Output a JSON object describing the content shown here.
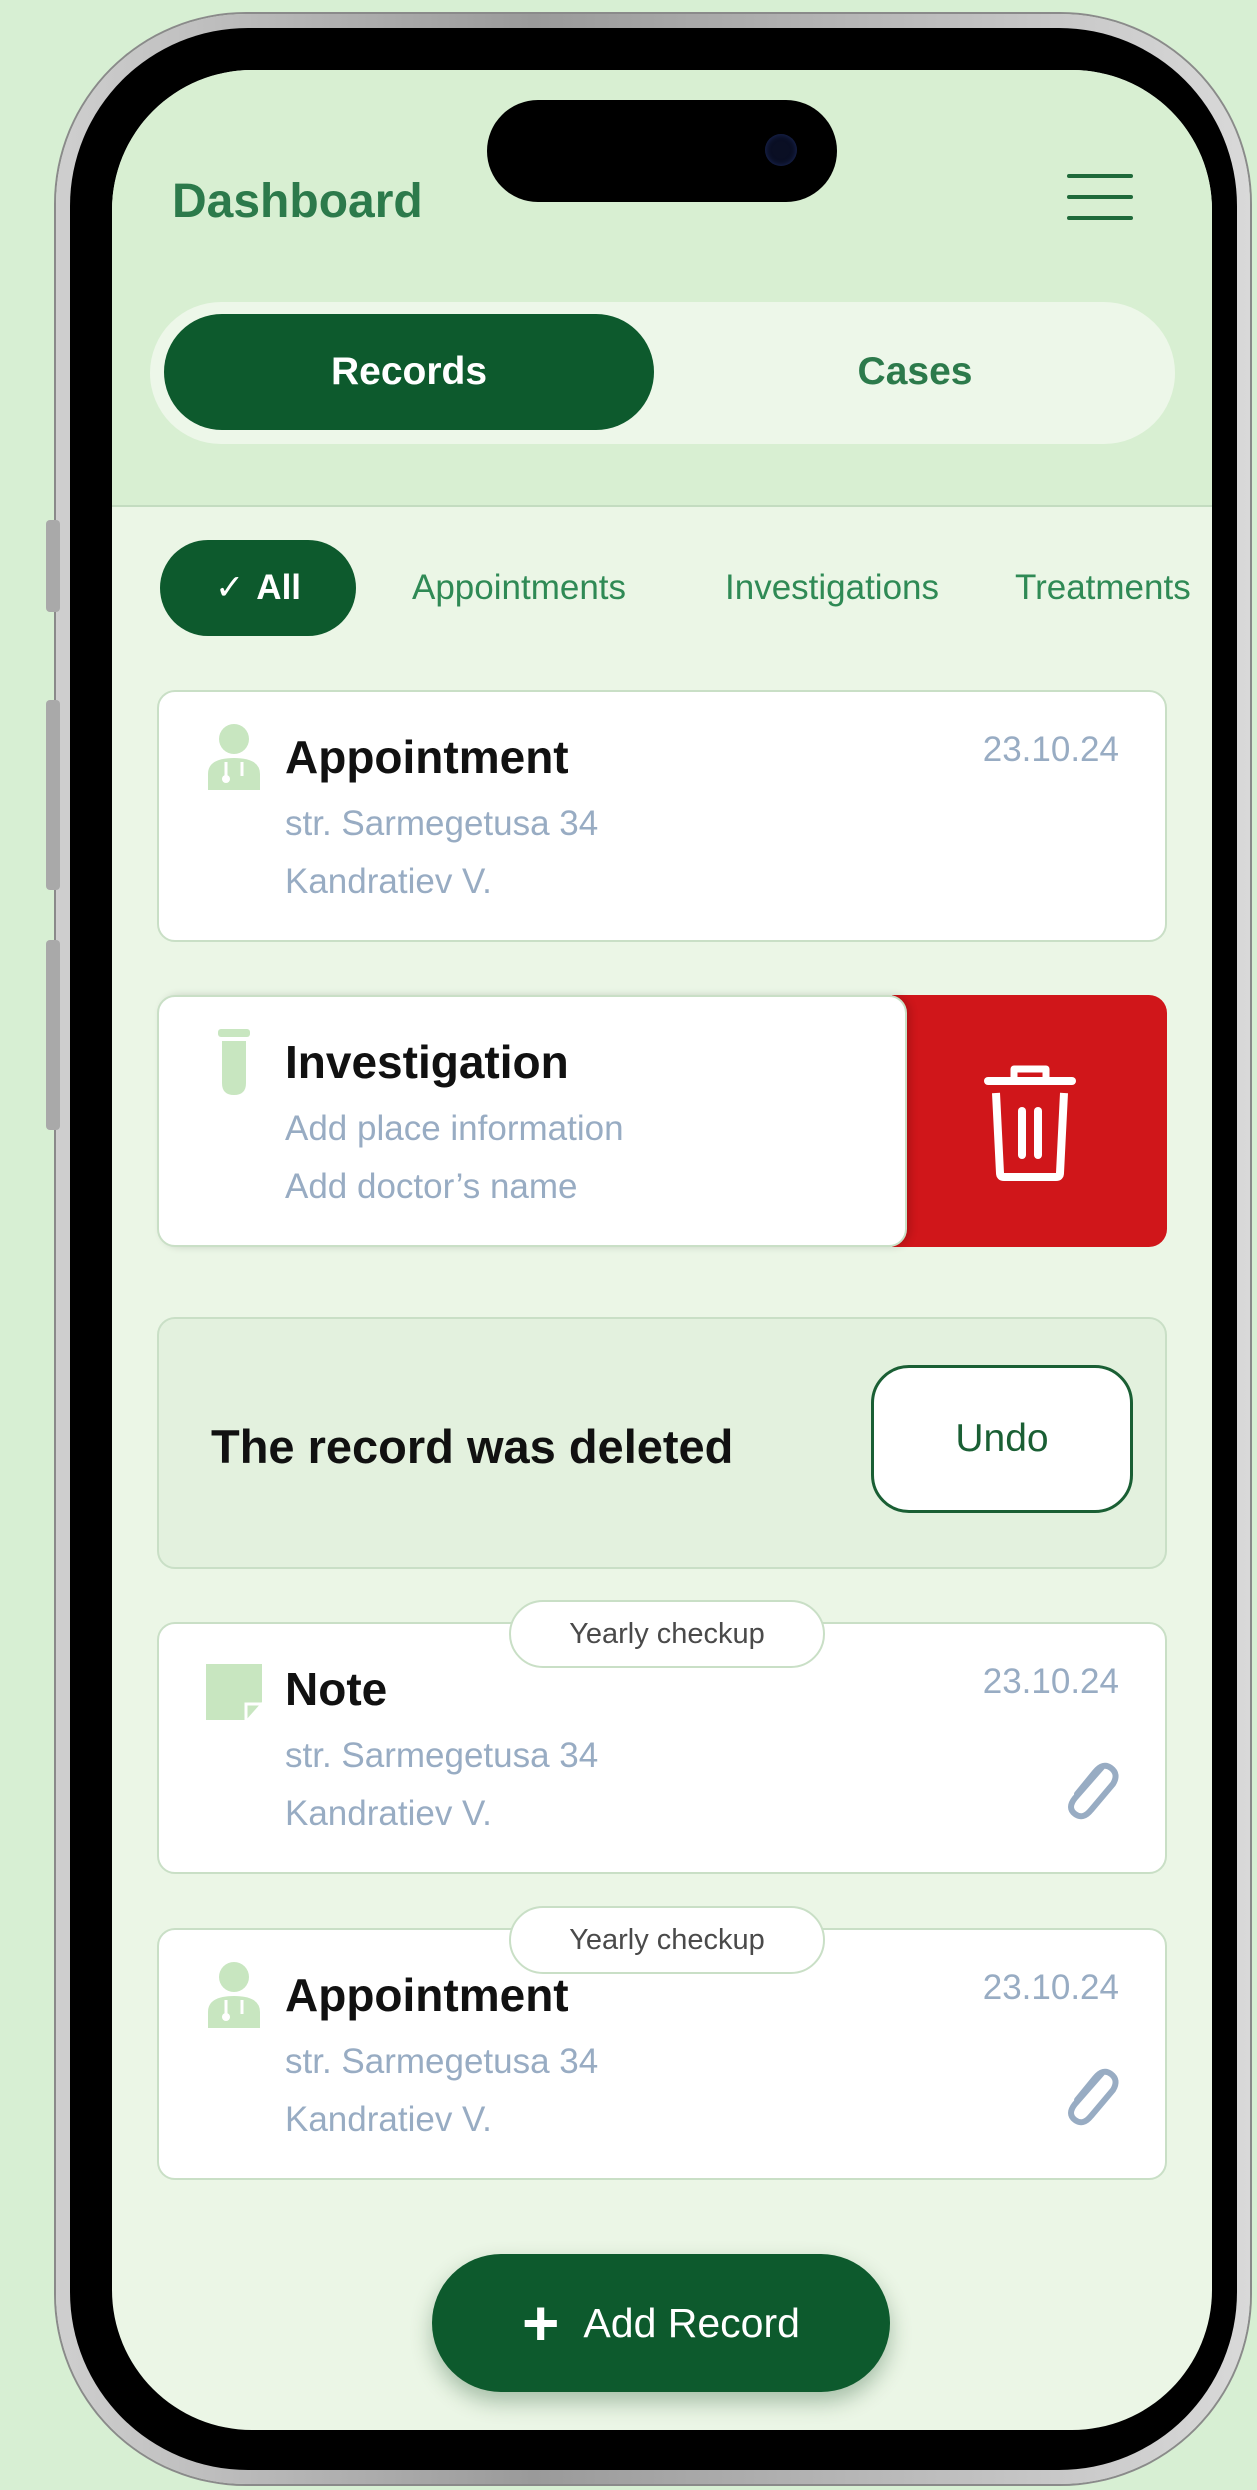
{
  "header": {
    "title": "Dashboard"
  },
  "segments": {
    "records": "Records",
    "cases": "Cases"
  },
  "filters": {
    "all": "All",
    "appointments": "Appointments",
    "investigations": "Investigations",
    "treatments": "Treatments"
  },
  "records": [
    {
      "type": "Appointment",
      "place": "str. Sarmegetusa 34",
      "doctor": "Kandratiev V.",
      "date": "23.10.24",
      "icon": "doctor-icon"
    },
    {
      "type": "Investigation",
      "place": "Add place information",
      "doctor": "Add doctor’s name",
      "icon": "test-tube-icon"
    },
    {
      "type": "Note",
      "place": "str. Sarmegetusa 34",
      "doctor": "Kandratiev V.",
      "date": "23.10.24",
      "tag": "Yearly checkup",
      "icon": "note-icon"
    },
    {
      "type": "Appointment",
      "place": "str. Sarmegetusa 34",
      "doctor": "Kandratiev V.",
      "date": "23.10.24",
      "tag": "Yearly checkup",
      "icon": "doctor-icon"
    }
  ],
  "snackbar": {
    "message": "The record was deleted",
    "undo": "Undo"
  },
  "fab": {
    "label": "Add Record"
  },
  "colors": {
    "primary": "#0d5a2d",
    "accent_text": "#2c7a4b",
    "delete": "#d0161a",
    "muted_text": "#98acc3",
    "background": "#ebf6e6"
  }
}
